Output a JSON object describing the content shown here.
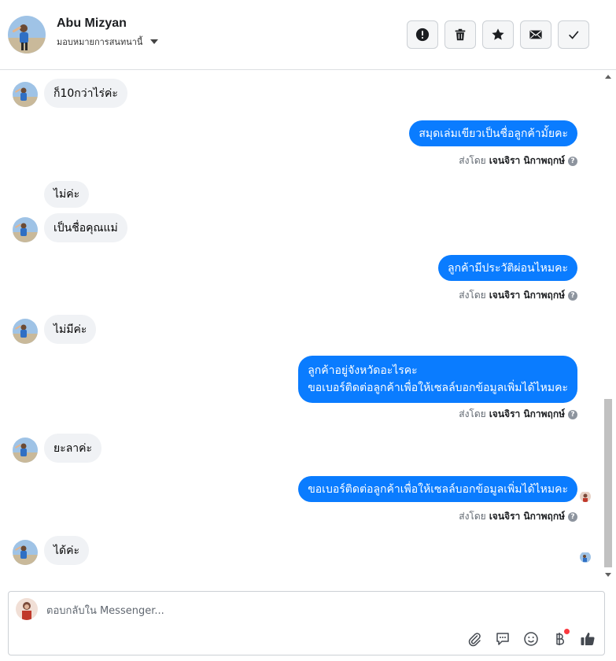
{
  "header": {
    "contact_name": "Abu Mizyan",
    "assign_label": "มอบหมายการสนทนานี้",
    "actions": [
      {
        "name": "report-button",
        "icon": "exclamation-icon"
      },
      {
        "name": "delete-button",
        "icon": "trash-icon"
      },
      {
        "name": "star-button",
        "icon": "star-icon"
      },
      {
        "name": "mark-unread-button",
        "icon": "envelope-icon"
      },
      {
        "name": "mark-done-button",
        "icon": "checkmark-icon"
      }
    ]
  },
  "conversation": {
    "messages": [
      {
        "direction": "in",
        "text": "ก็10กว่าไร่ค่ะ"
      },
      {
        "direction": "out",
        "text": "สมุดเล่มเขียวเป็นชื่อลูกค้ามั้ยคะ",
        "sent_by_label": "ส่งโดย",
        "sender": "เจนจิรา นิกาพฤกษ์"
      },
      {
        "direction": "in",
        "text": "ไม่ค่ะ"
      },
      {
        "direction": "in",
        "text": "เป็นชื่อคุณแม่"
      },
      {
        "direction": "out",
        "text": "ลูกค้ามีประวัติผ่อนไหมคะ",
        "sent_by_label": "ส่งโดย",
        "sender": "เจนจิรา นิกาพฤกษ์"
      },
      {
        "direction": "in",
        "text": "ไม่มีค่ะ"
      },
      {
        "direction": "out",
        "lines": [
          "ลูกค้าอยู่จังหวัดอะไรคะ",
          "ขอเบอร์ติดต่อลูกค้าเพื่อให้เซลล์บอกข้อมูลเพิ่มได้ไหมคะ"
        ],
        "sent_by_label": "ส่งโดย",
        "sender": "เจนจิรา นิกาพฤกษ์"
      },
      {
        "direction": "in",
        "text": "ยะลาค่ะ"
      },
      {
        "direction": "out",
        "text": "ขอเบอร์ติดต่อลูกค้าเพื่อให้เซลล์บอกข้อมูลเพิ่มได้ไหมคะ",
        "sent_by_label": "ส่งโดย",
        "sender": "เจนจิรา นิกาพฤกษ์"
      },
      {
        "direction": "in",
        "text": "ได้ค่ะ"
      }
    ]
  },
  "composer": {
    "placeholder": "ตอบกลับใน Messenger...",
    "tools": [
      "paperclip-icon",
      "speech-bubble-icon",
      "emoji-icon",
      "baht-icon",
      "thumbs-up-icon"
    ]
  },
  "colors": {
    "outgoing_bubble": "#0a7cff",
    "incoming_bubble": "#f0f2f5",
    "notification_dot": "#fa383e"
  }
}
